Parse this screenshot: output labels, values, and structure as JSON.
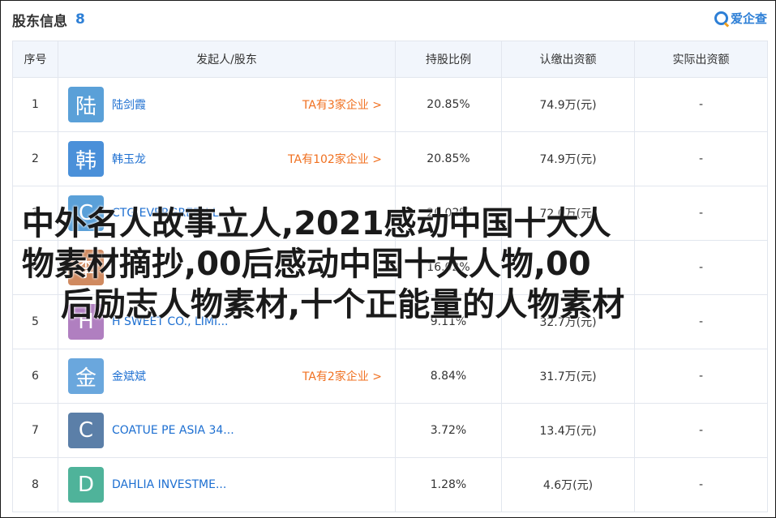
{
  "header": {
    "title": "股东信息",
    "count": "8"
  },
  "logo": {
    "name": "爱企查"
  },
  "table": {
    "columns": [
      "序号",
      "发起人/股东",
      "持股比例",
      "认缴出资额",
      "实际出资额"
    ],
    "rows": [
      {
        "idx": "1",
        "avatar": "陆",
        "avatar_color": "#5aa0d8",
        "name": "陆剑霞",
        "ta": "TA有3家企业 >",
        "ratio": "20.85%",
        "subscribed": "74.9万(元)",
        "paid": "-"
      },
      {
        "idx": "2",
        "avatar": "韩",
        "avatar_color": "#4a90d9",
        "name": "韩玉龙",
        "ta": "TA有102家企业 >",
        "ratio": "20.85%",
        "subscribed": "74.9万(元)",
        "paid": "-"
      },
      {
        "idx": "3",
        "avatar": "C",
        "avatar_color": "#5aa0d8",
        "name": "CTG EVERGREEN L...",
        "ta": "",
        "ratio": "20.02%",
        "subscribed": "72.0万(元)",
        "paid": "-"
      },
      {
        "idx": "4",
        "avatar": "李",
        "avatar_color": "#d08a60",
        "name": "",
        "ta": "",
        "ratio": "16.02%",
        "subscribed": "",
        "paid": "-"
      },
      {
        "idx": "5",
        "avatar": "H",
        "avatar_color": "#b07fc0",
        "name": "H SWEET CO., LIMI...",
        "ta": "",
        "ratio": "9.11%",
        "subscribed": "32.7万(元)",
        "paid": "-"
      },
      {
        "idx": "6",
        "avatar": "金",
        "avatar_color": "#6aa7dd",
        "name": "金斌斌",
        "ta": "TA有2家企业 >",
        "ratio": "8.84%",
        "subscribed": "31.7万(元)",
        "paid": "-"
      },
      {
        "idx": "7",
        "avatar": "C",
        "avatar_color": "#5b7fa8",
        "name": "COATUE PE ASIA 34...",
        "ta": "",
        "ratio": "3.72%",
        "subscribed": "13.4万(元)",
        "paid": "-"
      },
      {
        "idx": "8",
        "avatar": "D",
        "avatar_color": "#4fb39a",
        "name": "DAHLIA INVESTME...",
        "ta": "",
        "ratio": "1.28%",
        "subscribed": "4.6万(元)",
        "paid": "-"
      }
    ]
  },
  "overlay": {
    "line1": "中外名人故事立人,2021感动中国十大人",
    "line2": "物素材摘抄,00后感动中国十大人物,00",
    "line3": "后励志人物素材,十个正能量的人物素材"
  }
}
